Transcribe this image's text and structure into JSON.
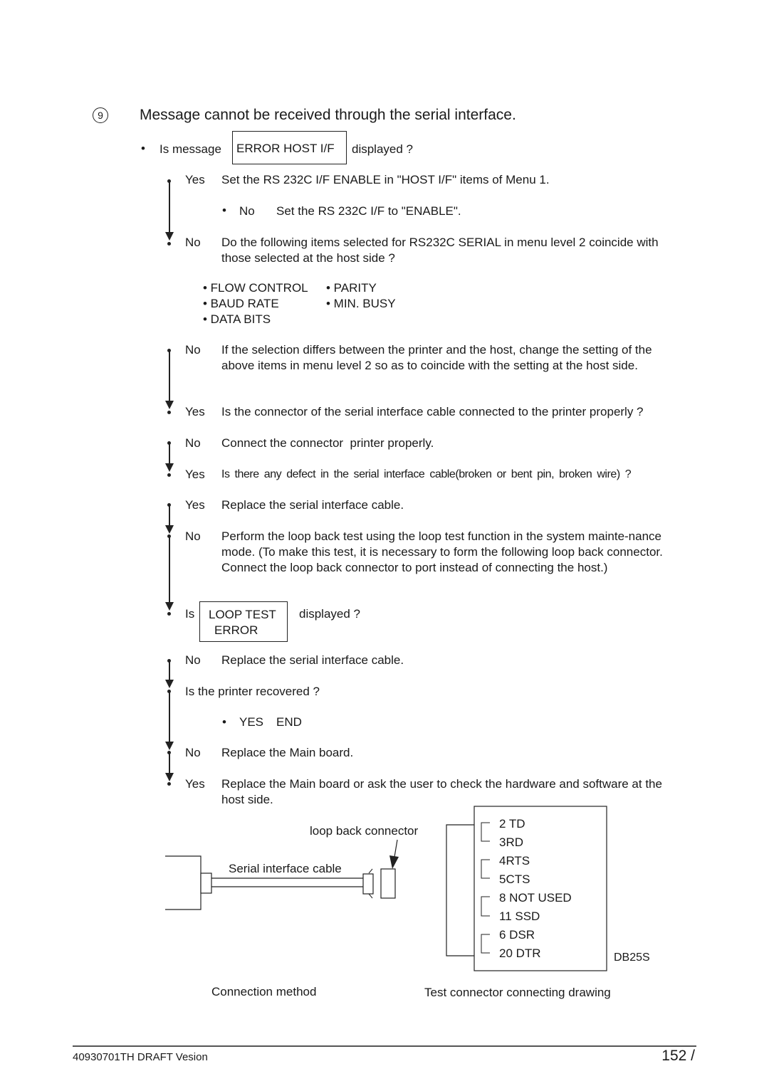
{
  "section": {
    "number": "9",
    "title": "Message cannot be received through the serial interface."
  },
  "q1": {
    "bullet": "•",
    "prefix": "Is message",
    "boxed": "ERROR HOST I/F",
    "suffix": "displayed ?"
  },
  "steps": [
    {
      "label": "Yes",
      "text": "Set the RS 232C I/F ENABLE in \"HOST I/F\" items of Menu 1."
    },
    {
      "label": "No",
      "text": "Set the RS 232C I/F to \"ENABLE\"."
    },
    {
      "label": "No",
      "text": "Do the following items selected for RS232C SERIAL in menu level 2 coincide with those selected at the host side ?"
    },
    {
      "label": "No",
      "text": "If the selection differs between the printer and the host, change the setting of the above items in menu level 2 so as to coincide with the setting at the host side."
    },
    {
      "label": "Yes",
      "text": "Is the connector of the serial interface cable connected to the printer properly ?"
    },
    {
      "label": "No",
      "text": "Connect the connector  printer properly."
    },
    {
      "label": "Yes",
      "text": "Is there any defect in the serial interface cable(broken or bent pin, broken wire) ?"
    },
    {
      "label": "Yes",
      "text": "Replace the serial interface cable."
    },
    {
      "label": "No",
      "text": "Perform the loop back test using the loop test function in the system mainte-nance mode. (To make this test, it is necessary to form the following loop back connector. Connect the loop back connector to port instead of connecting the host.)"
    },
    {
      "label": "No",
      "text": "Replace the serial interface cable."
    },
    {
      "label": "",
      "text": "Is the printer recovered ?"
    },
    {
      "label": "No",
      "text": "Replace the Main board."
    },
    {
      "label": "Yes",
      "text": "Replace the Main board or ask the user to check the hardware and software at the host side."
    }
  ],
  "settings_items": [
    "• FLOW CONTROL",
    "• PARITY",
    "• BAUD RATE",
    "• MIN. BUSY",
    "• DATA BITS"
  ],
  "loop_question": {
    "prefix": "Is",
    "boxed_line1": "LOOP TEST",
    "boxed_line2": "ERROR",
    "suffix": "displayed ?"
  },
  "yes_end": {
    "bullet": "•",
    "yes": "YES",
    "end": "END"
  },
  "diagram_left": {
    "loop_back_label": "loop back connector",
    "cable_label": "Serial interface cable",
    "caption": "Connection method"
  },
  "diagram_right": {
    "pins": [
      "2 TD",
      "3RD",
      "4RTS",
      "5CTS",
      "8 NOT USED",
      "11 SSD",
      "6 DSR",
      "20 DTR"
    ],
    "connector_label": "DB25S",
    "caption": "Test connector connecting drawing"
  },
  "footer": {
    "doc_id": "40930701TH  DRAFT Vesion",
    "page": "152 /"
  }
}
